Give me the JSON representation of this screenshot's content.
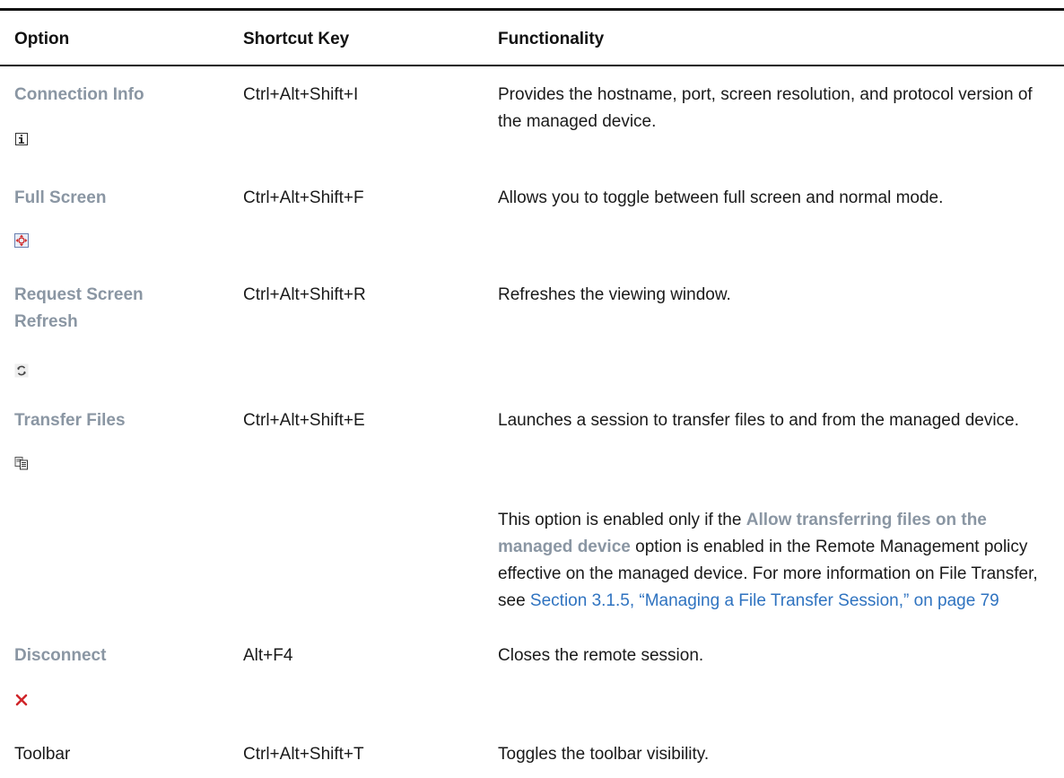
{
  "header": {
    "option": "Option",
    "shortcut": "Shortcut Key",
    "functionality": "Functionality"
  },
  "rows": [
    {
      "option": "Connection Info",
      "icon": "info-icon",
      "shortcut": "Ctrl+Alt+Shift+I",
      "functionality": "Provides the hostname, port, screen resolution, and protocol version of the managed device."
    },
    {
      "option": "Full Screen",
      "icon": "fullscreen-icon",
      "shortcut": "Ctrl+Alt+Shift+F",
      "functionality": "Allows you to toggle between full screen and normal mode."
    },
    {
      "option": "Request Screen Refresh",
      "icon": "refresh-icon",
      "shortcut": "Ctrl+Alt+Shift+R",
      "functionality": "Refreshes the viewing window."
    },
    {
      "option": "Transfer Files",
      "icon": "transfer-files-icon",
      "shortcut": "Ctrl+Alt+Shift+E",
      "functionality": "Launches a session to transfer files to and from the managed device.",
      "note": {
        "prefix": "This option is enabled only if the ",
        "highlight": "Allow transferring files on the managed device",
        "middle": " option is enabled in the Remote Management policy effective on the managed device. For more information on File Transfer, see ",
        "link": "Section 3.1.5, “Managing a File Transfer Session,” on page 79"
      }
    },
    {
      "option": "Disconnect",
      "icon": "close-icon",
      "shortcut": "Alt+F4",
      "functionality": "Closes the remote session."
    },
    {
      "option": "Toolbar",
      "shortcut": "Ctrl+Alt+Shift+T",
      "functionality": "Toggles the toolbar visibility."
    }
  ],
  "colors": {
    "option_text": "#8a96a3",
    "link": "#2f73c0",
    "disconnect_icon": "#d0262b"
  }
}
